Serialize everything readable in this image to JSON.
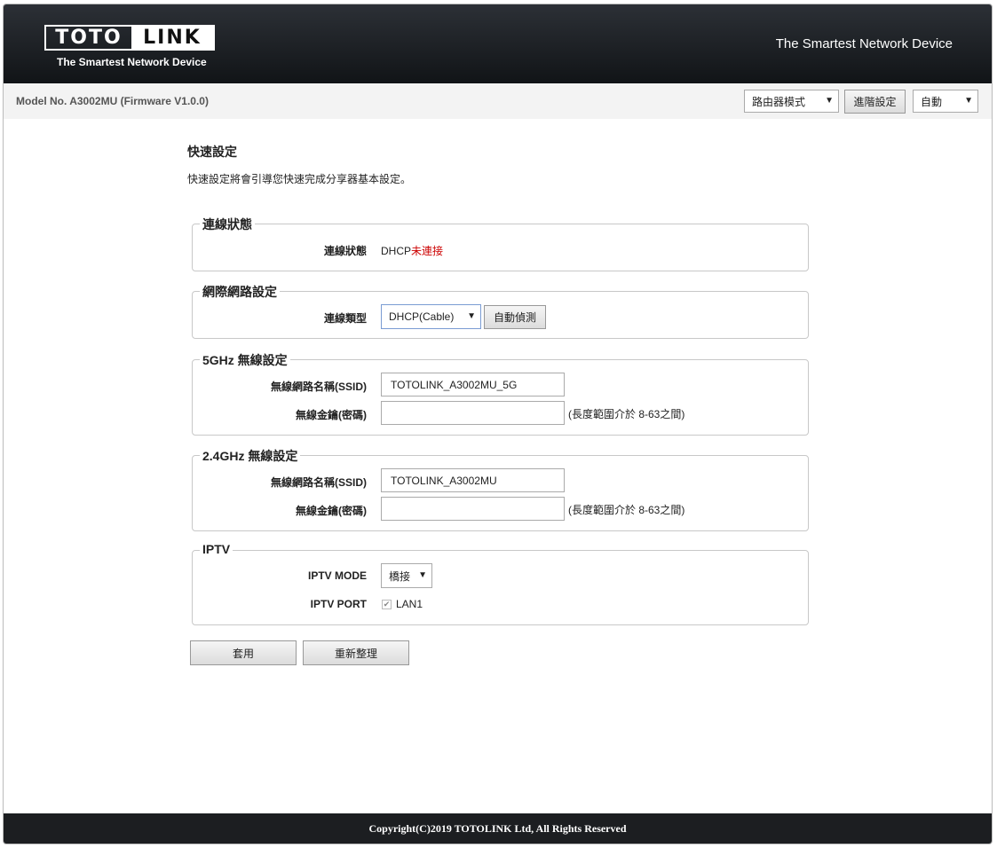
{
  "header": {
    "logo_left": "TOTO",
    "logo_right": "LINK",
    "logo_tagline": "The Smartest Network Device",
    "tagline": "The Smartest Network Device"
  },
  "topbar": {
    "model": "Model No. A3002MU (Firmware V1.0.0)",
    "mode_select": "路由器模式",
    "advanced_button": "進階設定",
    "language_select": "自動"
  },
  "page": {
    "title": "快速設定",
    "description": "快速設定將會引導您快速完成分享器基本設定。"
  },
  "connection_status": {
    "legend": "連線狀態",
    "label": "連線狀態",
    "value_prefix": "DHCP",
    "value_status": "未連接"
  },
  "internet": {
    "legend": "網際網路設定",
    "type_label": "連線類型",
    "type_value": "DHCP(Cable)",
    "auto_detect_button": "自動偵測"
  },
  "wifi_5g": {
    "legend": "5GHz 無線設定",
    "ssid_label": "無線網路名稱(SSID)",
    "ssid_value": "TOTOLINK_A3002MU_5G",
    "key_label": "無線金鑰(密碼)",
    "key_value": "",
    "key_hint": "(長度範圍介於 8-63之間)"
  },
  "wifi_24g": {
    "legend": "2.4GHz 無線設定",
    "ssid_label": "無線網路名稱(SSID)",
    "ssid_value": "TOTOLINK_A3002MU",
    "key_label": "無線金鑰(密碼)",
    "key_value": "",
    "key_hint": "(長度範圍介於 8-63之間)"
  },
  "iptv": {
    "legend": "IPTV",
    "mode_label": "IPTV MODE",
    "mode_value": "橋接",
    "port_label": "IPTV PORT",
    "port_value": "LAN1",
    "port_checked": true
  },
  "actions": {
    "apply_button": "套用",
    "refresh_button": "重新整理"
  },
  "footer": {
    "copyright": "Copyright(C)2019 TOTOLINK Ltd, All Rights Reserved"
  },
  "colors": {
    "header_bg": "#16191c",
    "status_red": "#cc0000",
    "footer_bg": "#1c1e21"
  }
}
